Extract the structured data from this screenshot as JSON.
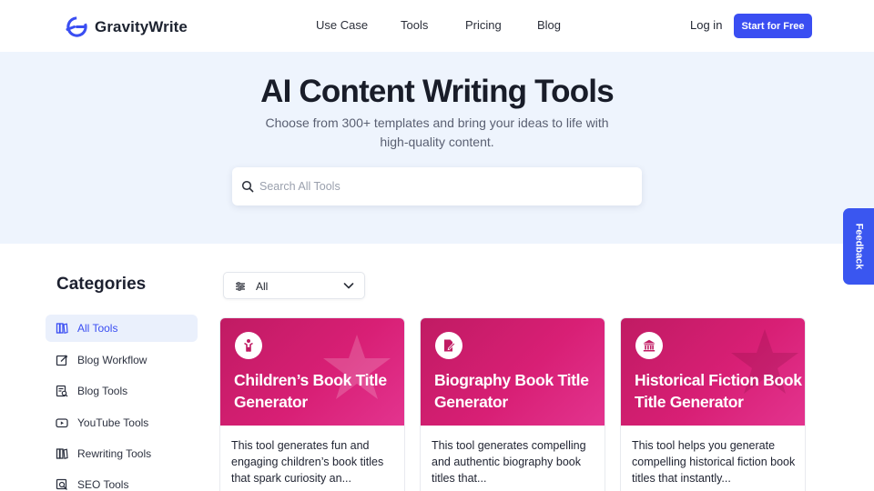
{
  "header": {
    "brand": "GravityWrite",
    "nav": [
      {
        "label": "Use Case"
      },
      {
        "label": "Tools"
      },
      {
        "label": "Pricing"
      },
      {
        "label": "Blog"
      }
    ],
    "login_label": "Log in",
    "cta_label": "Start for Free"
  },
  "hero": {
    "title": "AI Content Writing Tools",
    "subtitle": "Choose from 300+ templates and bring your ideas to life with high-quality content.",
    "search": {
      "placeholder": "Search All Tools",
      "value": ""
    }
  },
  "feedback_label": "Feedback",
  "sidebar": {
    "title": "Categories",
    "items": [
      {
        "label": "All Tools",
        "icon": "book-stack-icon",
        "active": true
      },
      {
        "label": "Blog Workflow",
        "icon": "edit-box-icon"
      },
      {
        "label": "Blog Tools",
        "icon": "blog-search-icon"
      },
      {
        "label": "YouTube Tools",
        "icon": "youtube-icon"
      },
      {
        "label": "Rewriting Tools",
        "icon": "rewrite-book-icon"
      },
      {
        "label": "SEO Tools",
        "icon": "seo-search-icon"
      }
    ]
  },
  "filter": {
    "label": "All",
    "icon": "sliders-icon"
  },
  "cards": [
    {
      "title": "Children’s Book Title Generator",
      "description": "This tool generates fun and engaging children’s book titles that spark curiosity an...",
      "icon": "child-icon"
    },
    {
      "title": "Biography Book Title Generator",
      "description": "This tool generates compelling and authentic biography book titles that...",
      "icon": "document-edit-icon"
    },
    {
      "title": "Historical Fiction Book Title Generator",
      "description": "This tool helps you generate compelling historical fiction book titles that instantly...",
      "icon": "museum-icon"
    }
  ],
  "colors": {
    "accent": "#3a4ef2",
    "card_gradient_start": "#c01b63",
    "card_gradient_end": "#e3348f",
    "hero_bg": "#eef4fd"
  }
}
